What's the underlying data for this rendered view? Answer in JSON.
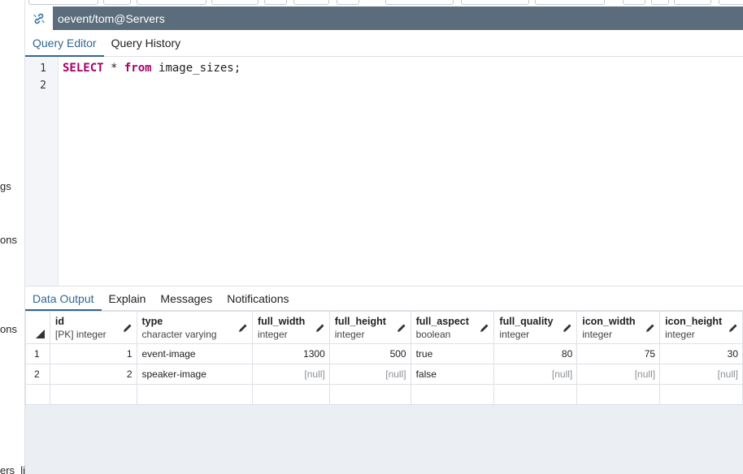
{
  "sidebar": {
    "fragments": [
      "gs",
      "ons",
      "ons",
      "ers_li"
    ]
  },
  "connection": {
    "title": "oevent/tom@Servers",
    "icon": "link-icon",
    "bar_color": "#5b6d7c"
  },
  "editor_tabs": [
    {
      "label": "Query Editor",
      "active": true
    },
    {
      "label": "Query History",
      "active": false
    }
  ],
  "editor": {
    "line_numbers": [
      "1",
      "2"
    ],
    "code": {
      "kw_select": "SELECT",
      "star": " * ",
      "kw_from": "from",
      "rest": " image_sizes;"
    }
  },
  "output_tabs": [
    {
      "label": "Data Output",
      "active": true
    },
    {
      "label": "Explain",
      "active": false
    },
    {
      "label": "Messages",
      "active": false
    },
    {
      "label": "Notifications",
      "active": false
    }
  ],
  "grid": {
    "columns": [
      {
        "name": "id",
        "type": "[PK] integer"
      },
      {
        "name": "type",
        "type": "character varying"
      },
      {
        "name": "full_width",
        "type": "integer"
      },
      {
        "name": "full_height",
        "type": "integer"
      },
      {
        "name": "full_aspect",
        "type": "boolean"
      },
      {
        "name": "full_quality",
        "type": "integer"
      },
      {
        "name": "icon_width",
        "type": "integer"
      },
      {
        "name": "icon_height",
        "type": "integer"
      }
    ],
    "rows": [
      {
        "num": "1",
        "cells": [
          "1",
          "event-image",
          "1300",
          "500",
          "true",
          "80",
          "75",
          "30"
        ]
      },
      {
        "num": "2",
        "cells": [
          "2",
          "speaker-image",
          "[null]",
          "[null]",
          "false",
          "[null]",
          "[null]",
          "[null]"
        ]
      }
    ],
    "accent": "#326690",
    "keyword_color": "#a50067"
  }
}
